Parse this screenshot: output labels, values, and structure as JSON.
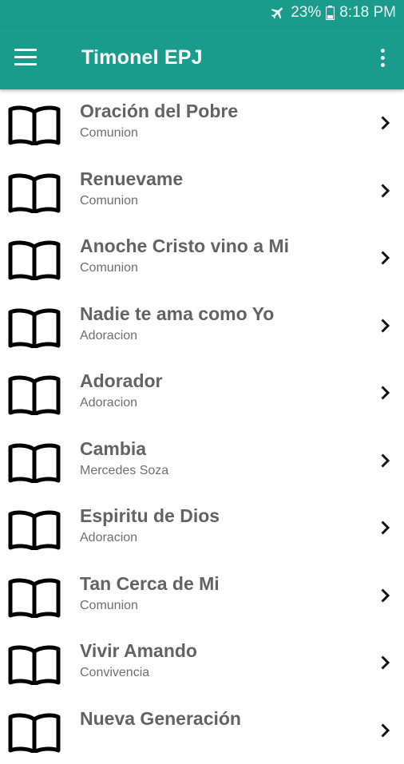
{
  "status_bar": {
    "icons": [
      "airplane-icon",
      "battery-icon"
    ],
    "battery": "23%",
    "time": "8:18 PM"
  },
  "app_bar": {
    "title": "Timonel EPJ",
    "icons": [
      "menu-icon",
      "overflow-menu-icon"
    ]
  },
  "colors": {
    "primary": "#199c8c",
    "title_text": "#636363",
    "subtitle_text": "#6f6f6f"
  },
  "songs": [
    {
      "title": "Oración del Pobre",
      "category": "Comunion"
    },
    {
      "title": "Renuevame",
      "category": "Comunion"
    },
    {
      "title": "Anoche Cristo vino a Mi",
      "category": "Comunion"
    },
    {
      "title": "Nadie te ama como Yo",
      "category": "Adoracion"
    },
    {
      "title": "Adorador",
      "category": "Adoracion"
    },
    {
      "title": "Cambia",
      "category": "Mercedes Soza"
    },
    {
      "title": "Espiritu de Dios",
      "category": "Adoracion"
    },
    {
      "title": "Tan Cerca de Mi",
      "category": "Comunion"
    },
    {
      "title": "Vivir Amando",
      "category": "Convivencia"
    },
    {
      "title": "Nueva Generación",
      "category": ""
    }
  ]
}
